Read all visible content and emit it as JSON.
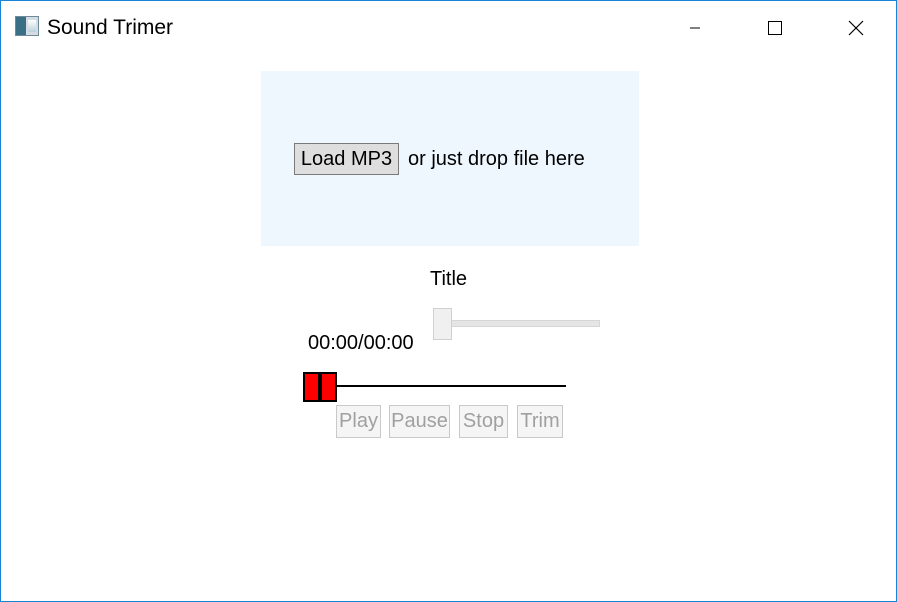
{
  "window": {
    "title": "Sound Trimer",
    "accent": "#1883d7"
  },
  "drop_zone": {
    "load_label": "Load MP3",
    "hint": "or just drop file here",
    "background": "#eef7fe"
  },
  "track": {
    "title": "Title",
    "time": "00:00/00:00",
    "volume_level": 0
  },
  "trim": {
    "handle_color": "#ff0000"
  },
  "controls": {
    "play": "Play",
    "pause": "Pause",
    "stop": "Stop",
    "trim": "Trim"
  },
  "icons": {
    "app": "app-icon",
    "minimize": "minimize-icon",
    "maximize": "maximize-icon",
    "close": "close-icon"
  }
}
